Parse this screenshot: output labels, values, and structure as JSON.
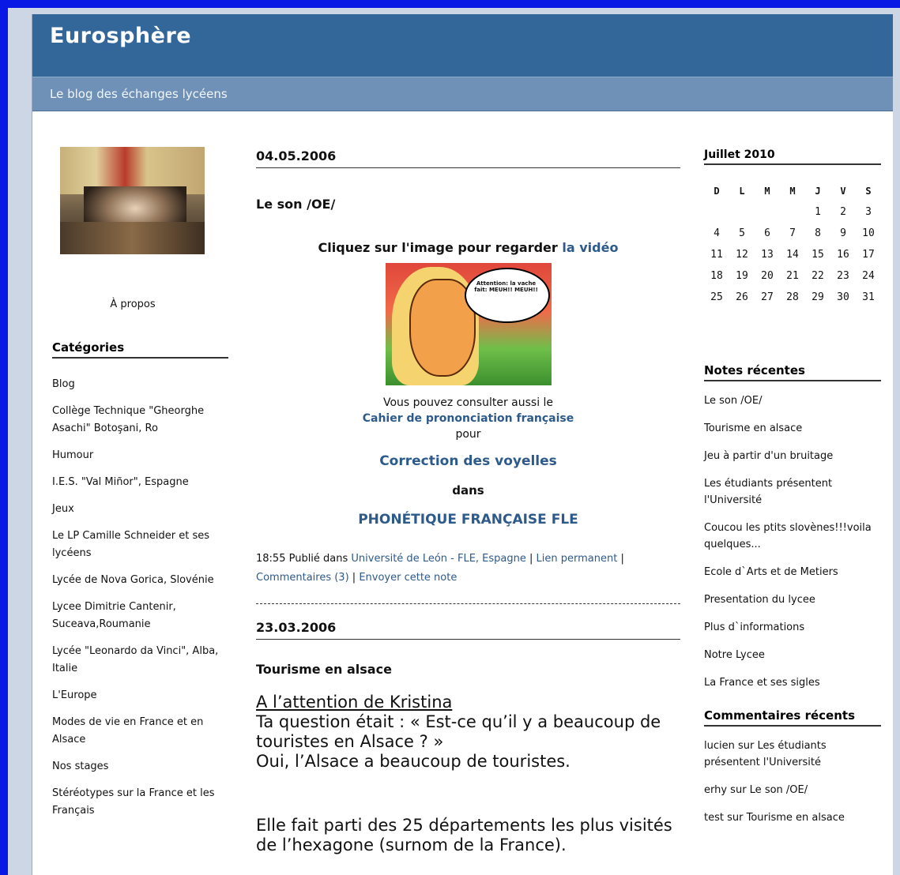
{
  "header": {
    "title": "Eurosphère",
    "tagline": "Le blog des échanges lycéens"
  },
  "sidebar_left": {
    "about": "À propos",
    "categories_title": "Catégories",
    "categories": [
      "Blog",
      "Collège Technique \"Gheorghe Asachi\" Botoşani, Ro",
      "Humour",
      "I.E.S. \"Val Miñor\", Espagne",
      "Jeux",
      "Le LP Camille Schneider et ses lycéens",
      "Lycée de Nova Gorica, Slovénie",
      "Lycee Dimitrie Cantenir, Suceava,Roumanie",
      "Lycée \"Leonardo da Vinci\", Alba, Italie",
      "L'Europe",
      "Modes de vie en France et en Alsace",
      "Nos stages",
      "Stéréotypes sur la France et les Français"
    ]
  },
  "posts": [
    {
      "date": "04.05.2006",
      "title": "Le son /OE/",
      "cta_text": "Cliquez sur l'image pour regarder ",
      "cta_link": "la vidéo",
      "image_bubble": "Attention: la vache fait: MEUH!! MEUH!!",
      "also_text": "Vous pouvez consulter aussi le",
      "also_link": "Cahier de prononciation française",
      "pour": "pour",
      "correction_link": "Correction des voyelles",
      "dans": "dans",
      "phonetique_link": "PHONÉTIQUE FRANÇAISE FLE",
      "meta_time": "18:55 Publié dans ",
      "meta_category": "Université de León - FLE, Espagne",
      "meta_permalink": "Lien permanent",
      "meta_comments": "Commentaires (3)",
      "meta_send": "Envoyer cette note",
      "sep": " | "
    },
    {
      "date": "23.03.2006",
      "title": "Tourisme en alsace",
      "heading": "A l’attention de Kristina",
      "p1": "Ta question était : « Est-ce qu’il y a beaucoup de touristes en Alsace ? »",
      "p2": "Oui, l’Alsace a beaucoup de touristes.",
      "p3": "Elle  fait parti des 25 départements les plus visités de l’hexagone (surnom de la France)."
    }
  ],
  "sidebar_right": {
    "calendar_title": "Juillet 2010",
    "weekdays": [
      "D",
      "L",
      "M",
      "M",
      "J",
      "V",
      "S"
    ],
    "weeks": [
      [
        "",
        "",
        "",
        "",
        "1",
        "2",
        "3"
      ],
      [
        "4",
        "5",
        "6",
        "7",
        "8",
        "9",
        "10"
      ],
      [
        "11",
        "12",
        "13",
        "14",
        "15",
        "16",
        "17"
      ],
      [
        "18",
        "19",
        "20",
        "21",
        "22",
        "23",
        "24"
      ],
      [
        "25",
        "26",
        "27",
        "28",
        "29",
        "30",
        "31"
      ]
    ],
    "notes_title": "Notes récentes",
    "notes": [
      "Le son /OE/",
      "Tourisme en alsace",
      "Jeu à partir d'un bruitage",
      "Les étudiants présentent l'Université",
      "Coucou les ptits slovènes!!!voila quelques...",
      "Ecole d`Arts et de Metiers",
      "Presentation du lycee",
      "Plus d`informations",
      "Notre Lycee",
      "La France et ses sigles"
    ],
    "comments_title": "Commentaires récents",
    "comments": [
      "lucien sur Les étudiants présentent l'Université",
      "erhy sur Le son /OE/",
      "test sur Tourisme en alsace"
    ]
  },
  "colors": {
    "header": "#336699",
    "subheader": "#6f91b7",
    "link": "#2d5a8a",
    "frame": "#0a18e6"
  }
}
